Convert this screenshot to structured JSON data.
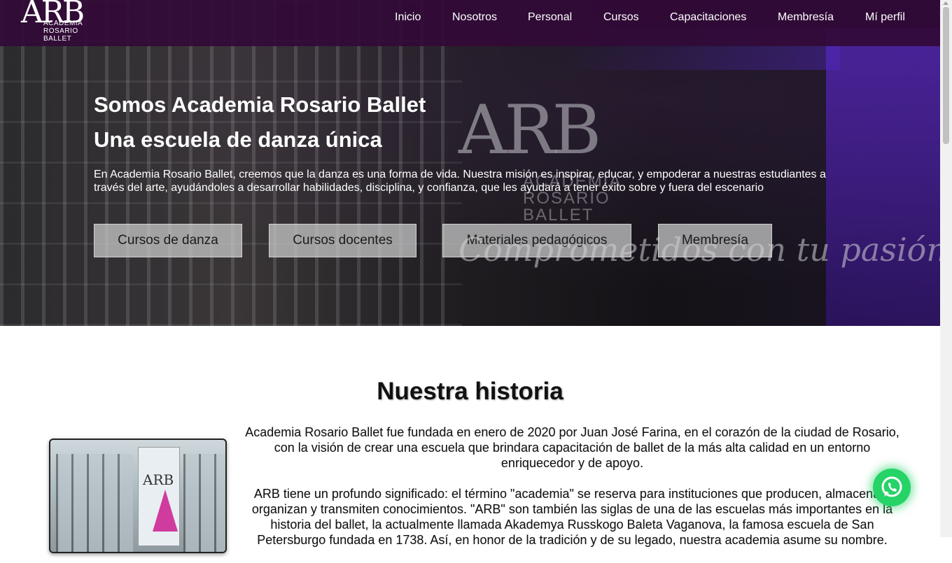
{
  "nav": {
    "logo_text": "ARB",
    "logo_sub": "ACADEMIA ROSARIO BALLET",
    "items": [
      "Inicio",
      "Nosotros",
      "Personal",
      "Cursos",
      "Capacitaciones",
      "Membresía",
      "Mí perfil"
    ]
  },
  "hero": {
    "title_line1": "Somos Academia Rosario Ballet",
    "title_line2": "Una escuela de danza única",
    "description": "En Academia Rosario Ballet, creemos que la danza es una forma de vida. Nuestra misión es inspirar, educar, y empoderar a nuestras estudiantes a través del arte, ayudándoles a desarrollar habilidades, disciplina, y confianza, que les ayudará a tener éxito sobre y fuera del escenario",
    "buttons": [
      "Cursos de danza",
      "Cursos docentes",
      "Materiales pedagógicos",
      "Membresía"
    ],
    "bg_logo_text": "ARB",
    "bg_logo_sub": "ACADEMIA ROSARIO BALLET",
    "tagline": "Comprometidos con tu pasión"
  },
  "history": {
    "title": "Nuestra historia",
    "paragraph1": "Academia Rosario Ballet fue fundada en enero de 2020 por Juan José Farina, en el corazón de la ciudad de Rosario, con la visión de crear una escuela que brindara capacitación de ballet de la más alta calidad en un entorno enriquecedor y de apoyo.",
    "paragraph2": "ARB tiene un profundo significado: el término \"academia\" se reserva para instituciones que producen, almacenan, organizan y transmiten conocimientos. \"ARB\" son también las siglas de una de las escuelas más importantes en la historia del ballet, la actualmente llamada Akademya Russkogo Baleta Vaganova, la famosa escuela de San Petersburgo fundada en 1738. Así, en honor de la tradición y de su legado, nuestra academia asume su nombre."
  },
  "colors": {
    "nav_bg": "#320a37",
    "whatsapp": "#25d366"
  },
  "icons": {
    "whatsapp": "whatsapp-icon"
  }
}
